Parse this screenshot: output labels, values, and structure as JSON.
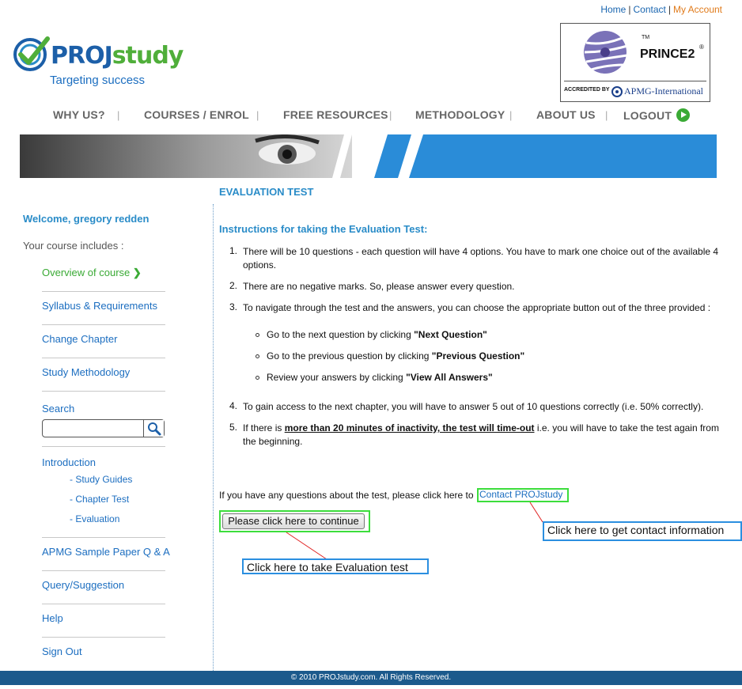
{
  "top_links": {
    "home": "Home",
    "contact": "Contact",
    "sep": "|",
    "account": "My Account"
  },
  "logo": {
    "word1": "PROJ",
    "word2": "study",
    "tagline": "Targeting success"
  },
  "badge": {
    "name": "PRINCE2",
    "tm": "TM",
    "reg": "®",
    "accredited": "ACCREDITED BY",
    "apmg": "APMG-International"
  },
  "nav": {
    "items": [
      "WHY US?",
      "COURSES / ENROL",
      "FREE RESOURCES",
      "METHODOLOGY",
      "ABOUT US",
      "LOGOUT"
    ],
    "sep": "|"
  },
  "page_title": "EVALUATION TEST",
  "sidebar": {
    "welcome": "Welcome, gregory redden",
    "includes": "Your course includes :",
    "overview": "Overview of course",
    "syllabus": "Syllabus & Requirements",
    "change_chapter": "Change Chapter",
    "study_method": "Study Methodology",
    "search_label": "Search",
    "search_value": "",
    "introduction": "Introduction",
    "sub": [
      "- Study Guides",
      "- Chapter Test",
      "- Evaluation"
    ],
    "apmg": "APMG Sample Paper Q & A",
    "query": "Query/Suggestion",
    "help": "Help",
    "signout": "Sign Out"
  },
  "main": {
    "instructions_title": "Instructions for taking the Evaluation Test:",
    "items": [
      {
        "num": "1.",
        "text": "There will be 10 questions - each question will have 4 options. You have to mark one choice out of the available 4 options."
      },
      {
        "num": "2.",
        "text": "There are no negative marks. So, please answer every question."
      },
      {
        "num": "3.",
        "text": "To navigate through the test and the answers, you can choose the appropriate button out of the three provided :"
      },
      {
        "num": "4.",
        "text": "To gain access to the next chapter, you will have to answer 5 out of 10 questions correctly (i.e. 50% correctly)."
      },
      {
        "num": "5.",
        "pre": "If there is ",
        "bold": "more than 20 minutes of inactivity, the test will time-out",
        "post": " i.e. you will have to take the test again from the beginning."
      }
    ],
    "bullets": [
      {
        "pre": "Go to the next question by clicking ",
        "bold": "\"Next Question\""
      },
      {
        "pre": "Go to the previous question by clicking ",
        "bold": "\"Previous Question\""
      },
      {
        "pre": "Review your answers by clicking ",
        "bold": "\"View All Answers\""
      }
    ],
    "questions_text": "If you have any questions about the test, please click here to",
    "contact_link": "Contact PROJstudy",
    "continue_button": "Please click here to continue",
    "callout_contact": "Click here to get contact information",
    "callout_eval": "Click here to take Evaluation test"
  },
  "footer": "© 2010 PROJstudy.com. All Rights Reserved.",
  "colors": {
    "accent_blue": "#2a8cc8",
    "brand_green": "#3aaa35",
    "footer_blue": "#1c5a8c",
    "annot_green": "#3cdd3c",
    "annot_blue": "#2b8fe0",
    "annot_line": "#e02020"
  }
}
